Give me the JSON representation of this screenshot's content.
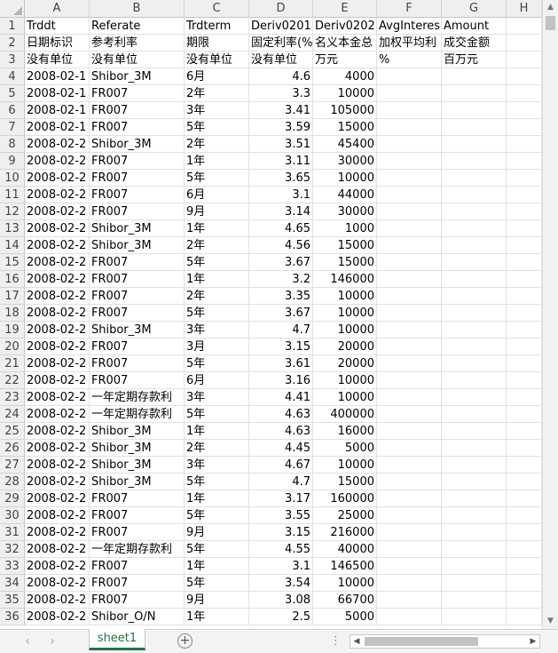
{
  "sheet": {
    "columns": [
      "A",
      "B",
      "C",
      "D",
      "E",
      "F",
      "G",
      "H"
    ],
    "rows": [
      {
        "n": "1",
        "cells": [
          "Trddt",
          "Referate",
          "Trdterm",
          "Deriv0201",
          "Deriv0202",
          "AvgInteres",
          "Amount",
          ""
        ]
      },
      {
        "n": "2",
        "cells": [
          "日期标识",
          "参考利率",
          "期限",
          "固定利率(%",
          "名义本金总",
          "加权平均利",
          "成交金额",
          ""
        ]
      },
      {
        "n": "3",
        "cells": [
          "没有单位",
          "没有单位",
          "没有单位",
          "没有单位",
          "万元",
          "%",
          "百万元",
          ""
        ]
      },
      {
        "n": "4",
        "cells": [
          "2008-02-1",
          "Shibor_3M",
          "6月",
          "4.6",
          "4000",
          "",
          "",
          ""
        ]
      },
      {
        "n": "5",
        "cells": [
          "2008-02-1",
          "FR007",
          "2年",
          "3.3",
          "10000",
          "",
          "",
          ""
        ]
      },
      {
        "n": "6",
        "cells": [
          "2008-02-1",
          "FR007",
          "3年",
          "3.41",
          "105000",
          "",
          "",
          ""
        ]
      },
      {
        "n": "7",
        "cells": [
          "2008-02-1",
          "FR007",
          "5年",
          "3.59",
          "15000",
          "",
          "",
          ""
        ]
      },
      {
        "n": "8",
        "cells": [
          "2008-02-2",
          "Shibor_3M",
          "2年",
          "3.51",
          "45400",
          "",
          "",
          ""
        ]
      },
      {
        "n": "9",
        "cells": [
          "2008-02-2",
          "FR007",
          "1年",
          "3.11",
          "30000",
          "",
          "",
          ""
        ]
      },
      {
        "n": "10",
        "cells": [
          "2008-02-2",
          "FR007",
          "5年",
          "3.65",
          "10000",
          "",
          "",
          ""
        ]
      },
      {
        "n": "11",
        "cells": [
          "2008-02-2",
          "FR007",
          "6月",
          "3.1",
          "44000",
          "",
          "",
          ""
        ]
      },
      {
        "n": "12",
        "cells": [
          "2008-02-2",
          "FR007",
          "9月",
          "3.14",
          "30000",
          "",
          "",
          ""
        ]
      },
      {
        "n": "13",
        "cells": [
          "2008-02-2",
          "Shibor_3M",
          "1年",
          "4.65",
          "1000",
          "",
          "",
          ""
        ]
      },
      {
        "n": "14",
        "cells": [
          "2008-02-2",
          "Shibor_3M",
          "2年",
          "4.56",
          "15000",
          "",
          "",
          ""
        ]
      },
      {
        "n": "15",
        "cells": [
          "2008-02-2",
          "FR007",
          "5年",
          "3.67",
          "15000",
          "",
          "",
          ""
        ]
      },
      {
        "n": "16",
        "cells": [
          "2008-02-2",
          "FR007",
          "1年",
          "3.2",
          "146000",
          "",
          "",
          ""
        ]
      },
      {
        "n": "17",
        "cells": [
          "2008-02-2",
          "FR007",
          "2年",
          "3.35",
          "10000",
          "",
          "",
          ""
        ]
      },
      {
        "n": "18",
        "cells": [
          "2008-02-2",
          "FR007",
          "5年",
          "3.67",
          "10000",
          "",
          "",
          ""
        ]
      },
      {
        "n": "19",
        "cells": [
          "2008-02-2",
          "Shibor_3M",
          "3年",
          "4.7",
          "10000",
          "",
          "",
          ""
        ]
      },
      {
        "n": "20",
        "cells": [
          "2008-02-2",
          "FR007",
          "3月",
          "3.15",
          "20000",
          "",
          "",
          ""
        ]
      },
      {
        "n": "21",
        "cells": [
          "2008-02-2",
          "FR007",
          "5年",
          "3.61",
          "20000",
          "",
          "",
          ""
        ]
      },
      {
        "n": "22",
        "cells": [
          "2008-02-2",
          "FR007",
          "6月",
          "3.16",
          "10000",
          "",
          "",
          ""
        ]
      },
      {
        "n": "23",
        "cells": [
          "2008-02-2",
          "一年定期存款利",
          "3年",
          "4.41",
          "10000",
          "",
          "",
          ""
        ]
      },
      {
        "n": "24",
        "cells": [
          "2008-02-2",
          "一年定期存款利",
          "5年",
          "4.63",
          "400000",
          "",
          "",
          ""
        ]
      },
      {
        "n": "25",
        "cells": [
          "2008-02-2",
          "Shibor_3M",
          "1年",
          "4.63",
          "16000",
          "",
          "",
          ""
        ]
      },
      {
        "n": "26",
        "cells": [
          "2008-02-2",
          "Shibor_3M",
          "2年",
          "4.45",
          "5000",
          "",
          "",
          ""
        ]
      },
      {
        "n": "27",
        "cells": [
          "2008-02-2",
          "Shibor_3M",
          "3年",
          "4.67",
          "10000",
          "",
          "",
          ""
        ]
      },
      {
        "n": "28",
        "cells": [
          "2008-02-2",
          "Shibor_3M",
          "5年",
          "4.7",
          "15000",
          "",
          "",
          ""
        ]
      },
      {
        "n": "29",
        "cells": [
          "2008-02-2",
          "FR007",
          "1年",
          "3.17",
          "160000",
          "",
          "",
          ""
        ]
      },
      {
        "n": "30",
        "cells": [
          "2008-02-2",
          "FR007",
          "5年",
          "3.55",
          "25000",
          "",
          "",
          ""
        ]
      },
      {
        "n": "31",
        "cells": [
          "2008-02-2",
          "FR007",
          "9月",
          "3.15",
          "216000",
          "",
          "",
          ""
        ]
      },
      {
        "n": "32",
        "cells": [
          "2008-02-2",
          "一年定期存款利",
          "5年",
          "4.55",
          "40000",
          "",
          "",
          ""
        ]
      },
      {
        "n": "33",
        "cells": [
          "2008-02-2",
          "FR007",
          "1年",
          "3.1",
          "146500",
          "",
          "",
          ""
        ]
      },
      {
        "n": "34",
        "cells": [
          "2008-02-2",
          "FR007",
          "5年",
          "3.54",
          "10000",
          "",
          "",
          ""
        ]
      },
      {
        "n": "35",
        "cells": [
          "2008-02-2",
          "FR007",
          "9月",
          "3.08",
          "66700",
          "",
          "",
          ""
        ]
      },
      {
        "n": "36",
        "cells": [
          "2008-02-2",
          "Shibor_O/N",
          "1年",
          "2.5",
          "5000",
          "",
          "",
          ""
        ]
      }
    ]
  },
  "tabs": {
    "active": "sheet1",
    "prev_icon": "‹",
    "next_icon": "›",
    "add_icon": "+",
    "ellipsis": "⋮"
  },
  "scroll": {
    "up": "▲",
    "down": "▼",
    "left": "◀",
    "right": "▶"
  },
  "colors": {
    "accent": "#217346",
    "header_bg": "#efefef",
    "grid_line": "#e1e1e1"
  }
}
